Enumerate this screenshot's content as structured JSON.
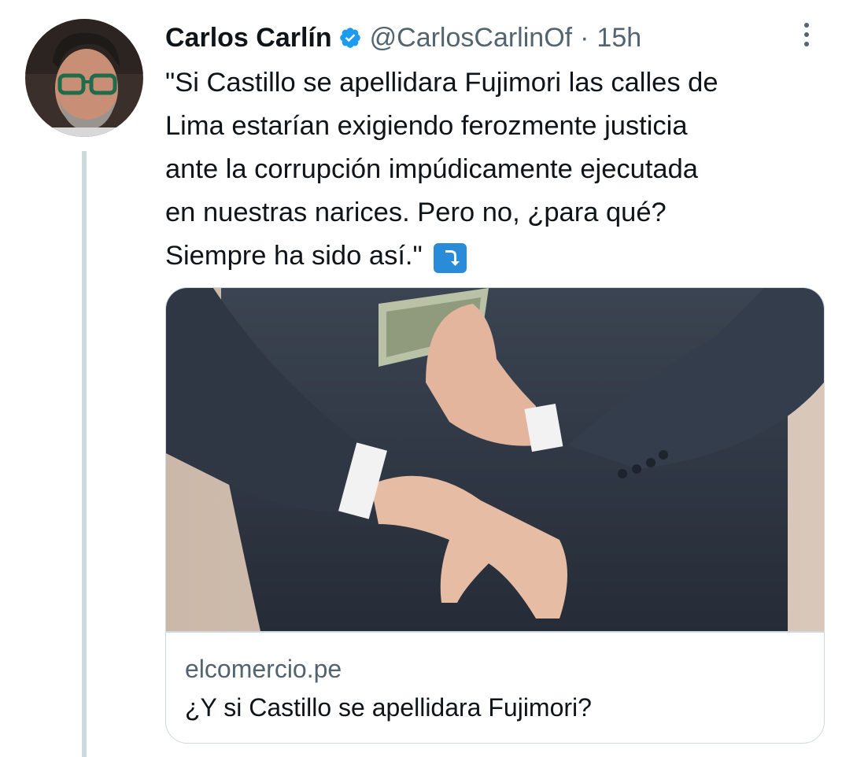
{
  "tweet": {
    "author": {
      "display_name": "Carlos Carlín",
      "handle": "@CarlosCarlinOf",
      "verified": true,
      "avatar_icon": "profile-photo"
    },
    "separator": "·",
    "time": "15h",
    "text_lines": [
      "\"Si Castillo se apellidara Fujimori las calles de",
      "Lima estarían exigiendo ferozmente justicia",
      "ante la corrupción impúdicamente ejecutada",
      "en nuestras narices. Pero no, ¿para qué?",
      "Siempre ha sido así.\""
    ],
    "emoji": "⤵",
    "more_icon": "more-vertical-icon",
    "link_card": {
      "image_icon": "photo-hands-behind-back-with-money",
      "domain": "elcomercio.pe",
      "title": "¿Y si Castillo se apellidara Fujimori?"
    }
  },
  "colors": {
    "text_primary": "#0f1419",
    "text_secondary": "#536471",
    "verified_blue": "#1d9bf0",
    "border": "#cfd9de",
    "emoji_blue": "#2a8bd9"
  }
}
